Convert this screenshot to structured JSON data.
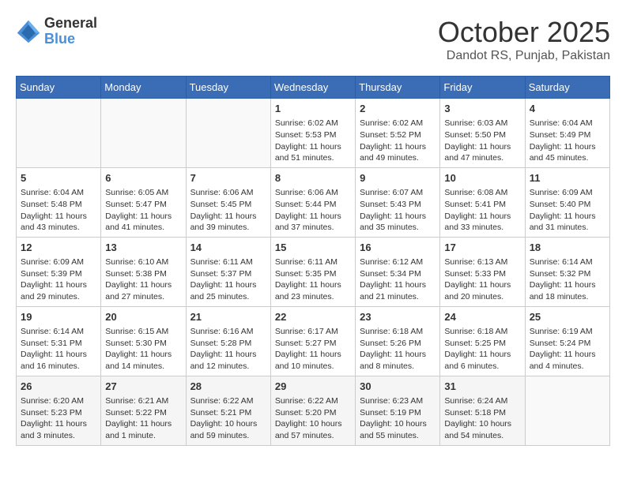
{
  "header": {
    "logo_general": "General",
    "logo_blue": "Blue",
    "month": "October 2025",
    "location": "Dandot RS, Punjab, Pakistan"
  },
  "days_of_week": [
    "Sunday",
    "Monday",
    "Tuesday",
    "Wednesday",
    "Thursday",
    "Friday",
    "Saturday"
  ],
  "weeks": [
    [
      {
        "day": "",
        "info": ""
      },
      {
        "day": "",
        "info": ""
      },
      {
        "day": "",
        "info": ""
      },
      {
        "day": "1",
        "info": "Sunrise: 6:02 AM\nSunset: 5:53 PM\nDaylight: 11 hours\nand 51 minutes."
      },
      {
        "day": "2",
        "info": "Sunrise: 6:02 AM\nSunset: 5:52 PM\nDaylight: 11 hours\nand 49 minutes."
      },
      {
        "day": "3",
        "info": "Sunrise: 6:03 AM\nSunset: 5:50 PM\nDaylight: 11 hours\nand 47 minutes."
      },
      {
        "day": "4",
        "info": "Sunrise: 6:04 AM\nSunset: 5:49 PM\nDaylight: 11 hours\nand 45 minutes."
      }
    ],
    [
      {
        "day": "5",
        "info": "Sunrise: 6:04 AM\nSunset: 5:48 PM\nDaylight: 11 hours\nand 43 minutes."
      },
      {
        "day": "6",
        "info": "Sunrise: 6:05 AM\nSunset: 5:47 PM\nDaylight: 11 hours\nand 41 minutes."
      },
      {
        "day": "7",
        "info": "Sunrise: 6:06 AM\nSunset: 5:45 PM\nDaylight: 11 hours\nand 39 minutes."
      },
      {
        "day": "8",
        "info": "Sunrise: 6:06 AM\nSunset: 5:44 PM\nDaylight: 11 hours\nand 37 minutes."
      },
      {
        "day": "9",
        "info": "Sunrise: 6:07 AM\nSunset: 5:43 PM\nDaylight: 11 hours\nand 35 minutes."
      },
      {
        "day": "10",
        "info": "Sunrise: 6:08 AM\nSunset: 5:41 PM\nDaylight: 11 hours\nand 33 minutes."
      },
      {
        "day": "11",
        "info": "Sunrise: 6:09 AM\nSunset: 5:40 PM\nDaylight: 11 hours\nand 31 minutes."
      }
    ],
    [
      {
        "day": "12",
        "info": "Sunrise: 6:09 AM\nSunset: 5:39 PM\nDaylight: 11 hours\nand 29 minutes."
      },
      {
        "day": "13",
        "info": "Sunrise: 6:10 AM\nSunset: 5:38 PM\nDaylight: 11 hours\nand 27 minutes."
      },
      {
        "day": "14",
        "info": "Sunrise: 6:11 AM\nSunset: 5:37 PM\nDaylight: 11 hours\nand 25 minutes."
      },
      {
        "day": "15",
        "info": "Sunrise: 6:11 AM\nSunset: 5:35 PM\nDaylight: 11 hours\nand 23 minutes."
      },
      {
        "day": "16",
        "info": "Sunrise: 6:12 AM\nSunset: 5:34 PM\nDaylight: 11 hours\nand 21 minutes."
      },
      {
        "day": "17",
        "info": "Sunrise: 6:13 AM\nSunset: 5:33 PM\nDaylight: 11 hours\nand 20 minutes."
      },
      {
        "day": "18",
        "info": "Sunrise: 6:14 AM\nSunset: 5:32 PM\nDaylight: 11 hours\nand 18 minutes."
      }
    ],
    [
      {
        "day": "19",
        "info": "Sunrise: 6:14 AM\nSunset: 5:31 PM\nDaylight: 11 hours\nand 16 minutes."
      },
      {
        "day": "20",
        "info": "Sunrise: 6:15 AM\nSunset: 5:30 PM\nDaylight: 11 hours\nand 14 minutes."
      },
      {
        "day": "21",
        "info": "Sunrise: 6:16 AM\nSunset: 5:28 PM\nDaylight: 11 hours\nand 12 minutes."
      },
      {
        "day": "22",
        "info": "Sunrise: 6:17 AM\nSunset: 5:27 PM\nDaylight: 11 hours\nand 10 minutes."
      },
      {
        "day": "23",
        "info": "Sunrise: 6:18 AM\nSunset: 5:26 PM\nDaylight: 11 hours\nand 8 minutes."
      },
      {
        "day": "24",
        "info": "Sunrise: 6:18 AM\nSunset: 5:25 PM\nDaylight: 11 hours\nand 6 minutes."
      },
      {
        "day": "25",
        "info": "Sunrise: 6:19 AM\nSunset: 5:24 PM\nDaylight: 11 hours\nand 4 minutes."
      }
    ],
    [
      {
        "day": "26",
        "info": "Sunrise: 6:20 AM\nSunset: 5:23 PM\nDaylight: 11 hours\nand 3 minutes."
      },
      {
        "day": "27",
        "info": "Sunrise: 6:21 AM\nSunset: 5:22 PM\nDaylight: 11 hours\nand 1 minute."
      },
      {
        "day": "28",
        "info": "Sunrise: 6:22 AM\nSunset: 5:21 PM\nDaylight: 10 hours\nand 59 minutes."
      },
      {
        "day": "29",
        "info": "Sunrise: 6:22 AM\nSunset: 5:20 PM\nDaylight: 10 hours\nand 57 minutes."
      },
      {
        "day": "30",
        "info": "Sunrise: 6:23 AM\nSunset: 5:19 PM\nDaylight: 10 hours\nand 55 minutes."
      },
      {
        "day": "31",
        "info": "Sunrise: 6:24 AM\nSunset: 5:18 PM\nDaylight: 10 hours\nand 54 minutes."
      },
      {
        "day": "",
        "info": ""
      }
    ]
  ]
}
